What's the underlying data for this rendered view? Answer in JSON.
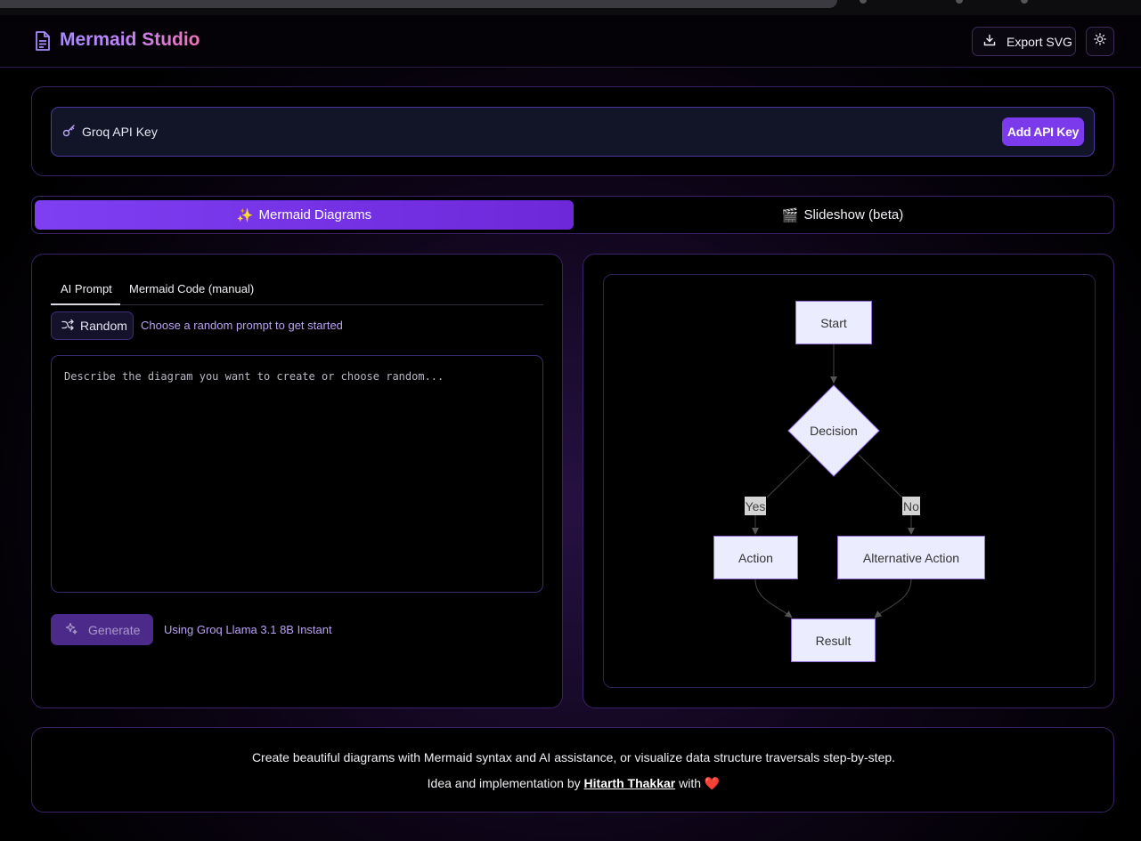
{
  "app": {
    "title": "Mermaid Studio"
  },
  "header": {
    "export_label": "Export SVG",
    "export_icon": "download-icon",
    "theme_icon": "sun-icon"
  },
  "api": {
    "label": "Groq API Key",
    "button": "Add API Key"
  },
  "tabs": [
    {
      "emoji": "✨",
      "label": "Mermaid Diagrams",
      "active": true
    },
    {
      "emoji": "🎬",
      "label": "Slideshow (beta)",
      "active": false
    }
  ],
  "editor": {
    "subtabs": [
      "AI Prompt",
      "Mermaid Code (manual)"
    ],
    "random_label": "Random",
    "random_hint": "Choose a random prompt to get started",
    "prompt_placeholder": "Describe the diagram you want to create or choose random...",
    "generate_label": "Generate",
    "model_text": "Using Groq Llama 3.1 8B Instant"
  },
  "diagram": {
    "nodes": {
      "start": "Start",
      "decision": "Decision",
      "action": "Action",
      "alt": "Alternative Action",
      "result": "Result"
    },
    "edges": {
      "yes": "Yes",
      "no": "No"
    }
  },
  "footer": {
    "line1": "Create beautiful diagrams with Mermaid syntax and AI assistance, or visualize data structure traversals step-by-step.",
    "line2_prefix": "Idea and implementation by ",
    "author": "Hitarth Thakkar",
    "line2_suffix": " with ",
    "heart": "❤️"
  },
  "colors": {
    "accent": "#7c3aed",
    "background": "#000000",
    "node_fill": "#ececff",
    "node_border": "#9370db"
  }
}
